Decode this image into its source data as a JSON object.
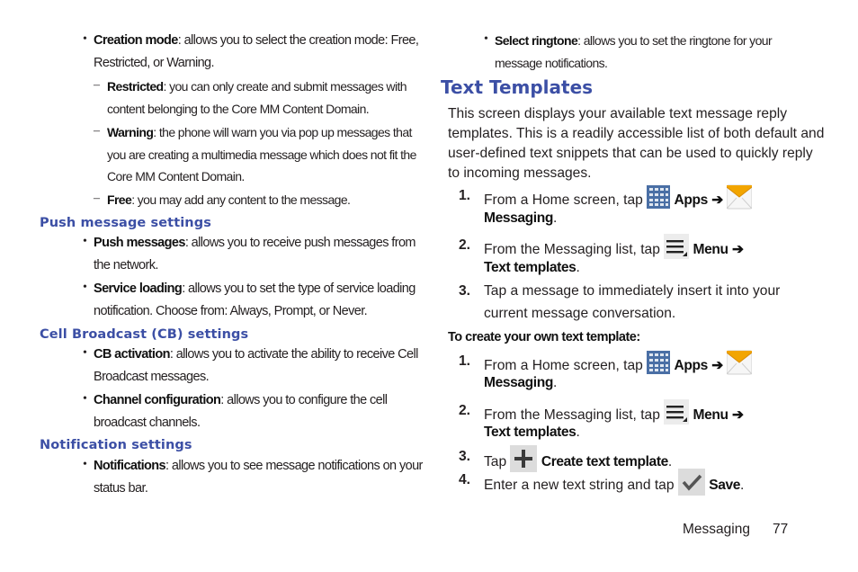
{
  "left_column": {
    "creation_mode": {
      "term": "Creation mode",
      "line1": ": allows you to select the creation mode: Free,",
      "line2": "Restricted, or Warning.",
      "sub_items": [
        {
          "term": "Restricted",
          "line1": ": you can only create and submit messages with",
          "line2": "content belonging to the Core MM Content Domain."
        },
        {
          "term": "Warning",
          "line1": ": the phone will warn you via pop up messages that",
          "line2": "you are creating a multimedia message which does not fit the",
          "line3": "Core MM Content Domain."
        },
        {
          "term": "Free",
          "line1": ": you may add any content to the message."
        }
      ]
    },
    "sections": [
      {
        "heading": "Push message settings",
        "items": [
          {
            "term": "Push messages",
            "line1": ": allows you to receive push messages from",
            "line2": "the network."
          },
          {
            "term": "Service loading",
            "line1": ": allows you to set the type of service loading",
            "line2": "notification. Choose from: Always, Prompt, or Never."
          }
        ]
      },
      {
        "heading": "Cell Broadcast (CB) settings",
        "items": [
          {
            "term": "CB activation",
            "line1": ": allows you to activate the ability to receive Cell",
            "line2": "Broadcast messages."
          },
          {
            "term": "Channel configuration",
            "line1": ": allows you to configure the cell",
            "line2": "broadcast channels."
          }
        ]
      },
      {
        "heading": "Notification settings",
        "items": [
          {
            "term": "Notifications",
            "line1": ": allows you to see message notifications on your",
            "line2": "status bar."
          }
        ]
      }
    ]
  },
  "right_column": {
    "select_ringtone": {
      "term": "Select ringtone",
      "line1": ": allows you to set the ringtone for your",
      "line2": "message notifications."
    },
    "title": "Text Templates",
    "intro_lines": [
      "This screen displays your available text message reply",
      "templates. This is a readily accessible list of both default and",
      "user-defined text snippets that can be used to quickly reply",
      "to incoming messages."
    ],
    "steps_a": [
      {
        "num": "1.",
        "pre": "From a Home screen, tap ",
        "apps": "Apps",
        "arrow": "➔",
        "line2": "Messaging",
        "end": "."
      },
      {
        "num": "2.",
        "pre": "From the Messaging list, tap ",
        "menu": "Menu",
        "arrow": "➔",
        "line2": "Text templates",
        "end": "."
      },
      {
        "num": "3.",
        "line1": "Tap a message to immediately insert it into your",
        "line2": "current message conversation."
      }
    ],
    "procedure_label": "To create your own text template:",
    "steps_b": [
      {
        "num": "1.",
        "pre": "From a Home screen, tap ",
        "apps": "Apps",
        "arrow": "➔",
        "line2": "Messaging",
        "end": "."
      },
      {
        "num": "2.",
        "pre": "From the Messaging list, tap ",
        "menu": "Menu",
        "arrow": "➔",
        "line2": "Text templates",
        "end": "."
      },
      {
        "num": "3.",
        "pre": "Tap ",
        "action": "Create text template",
        "end": "."
      },
      {
        "num": "4.",
        "pre": "Enter a new text string and tap ",
        "action": "Save",
        "end": "."
      }
    ]
  },
  "icons": {
    "apps": "apps-grid-icon",
    "messaging": "messaging-envelope-icon",
    "menu": "menu-icon",
    "add": "plus-icon",
    "save": "checkmark-icon"
  },
  "footer": {
    "section": "Messaging",
    "page_number": "77"
  },
  "colors": {
    "heading": "#3c4fa5",
    "body": "#231f20",
    "apps_icon": "#4a6fa5",
    "envelope": "#f2a500"
  }
}
